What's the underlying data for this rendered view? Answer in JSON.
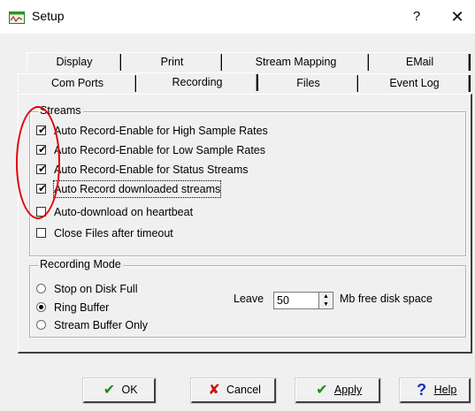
{
  "window": {
    "title": "Setup",
    "help_glyph": "?",
    "close_glyph": "✕"
  },
  "tabs": {
    "row1": [
      "Display",
      "Print",
      "Stream Mapping",
      "EMail"
    ],
    "row2": [
      "Com Ports",
      "Recording",
      "Files",
      "Event Log"
    ],
    "active": "Recording"
  },
  "streams": {
    "label": "Streams",
    "options": [
      {
        "label": "Auto Record-Enable for High Sample Rates",
        "checked": true
      },
      {
        "label": "Auto Record-Enable for Low Sample Rates",
        "checked": true
      },
      {
        "label": "Auto Record-Enable for Status Streams",
        "checked": true
      },
      {
        "label": "Auto Record downloaded streams",
        "checked": true
      },
      {
        "label": "Auto-download on heartbeat",
        "checked": false
      },
      {
        "label": "Close Files after timeout",
        "checked": false
      }
    ]
  },
  "recording_mode": {
    "label": "Recording Mode",
    "options": [
      {
        "label": "Stop on Disk Full",
        "selected": false
      },
      {
        "label": "Ring Buffer",
        "selected": true
      },
      {
        "label": "Stream Buffer Only",
        "selected": false
      }
    ],
    "leave_label": "Leave",
    "leave_value": "50",
    "suffix": "Mb free disk space"
  },
  "buttons": {
    "ok": "OK",
    "cancel": "Cancel",
    "apply": "Apply",
    "help": "Help"
  },
  "colors": {
    "annotation": "#e00000",
    "ok_icon": "#1a8c1a",
    "cancel_icon": "#cc1111",
    "help_icon": "#1030c0"
  }
}
